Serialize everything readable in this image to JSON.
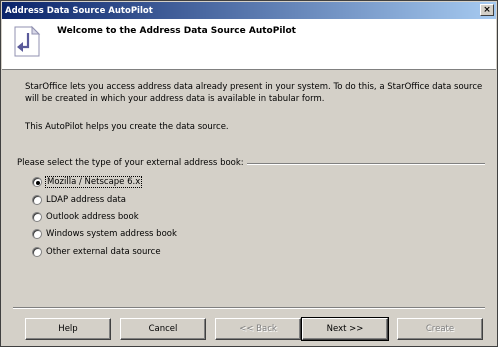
{
  "window": {
    "title": "Address Data Source AutoPilot",
    "close_glyph": "×"
  },
  "header": {
    "title": "Welcome to the Address Data Source AutoPilot",
    "icon": "autopilot-icon"
  },
  "body": {
    "paragraph1": "StarOffice lets you access address data already present in your system. To do this, a StarOffice data source will be created in which your address data is available in tabular form.",
    "paragraph2": "This AutoPilot helps you create the data source."
  },
  "group": {
    "label": "Please select the type of your external address book:",
    "options": [
      {
        "label": "Mozilla / Netscape 6.x",
        "checked": true
      },
      {
        "label": "LDAP address data",
        "checked": false
      },
      {
        "label": "Outlook address book",
        "checked": false
      },
      {
        "label": "Windows system address book",
        "checked": false
      },
      {
        "label": "Other external data source",
        "checked": false
      }
    ]
  },
  "buttons": {
    "help": "Help",
    "cancel": "Cancel",
    "back": "<< Back",
    "next": "Next >>",
    "create": "Create"
  },
  "colors": {
    "titlebar_start": "#0a246a",
    "titlebar_end": "#a6caf0",
    "dialog_bg": "#d4d0c8",
    "header_bg": "#ffffff"
  }
}
